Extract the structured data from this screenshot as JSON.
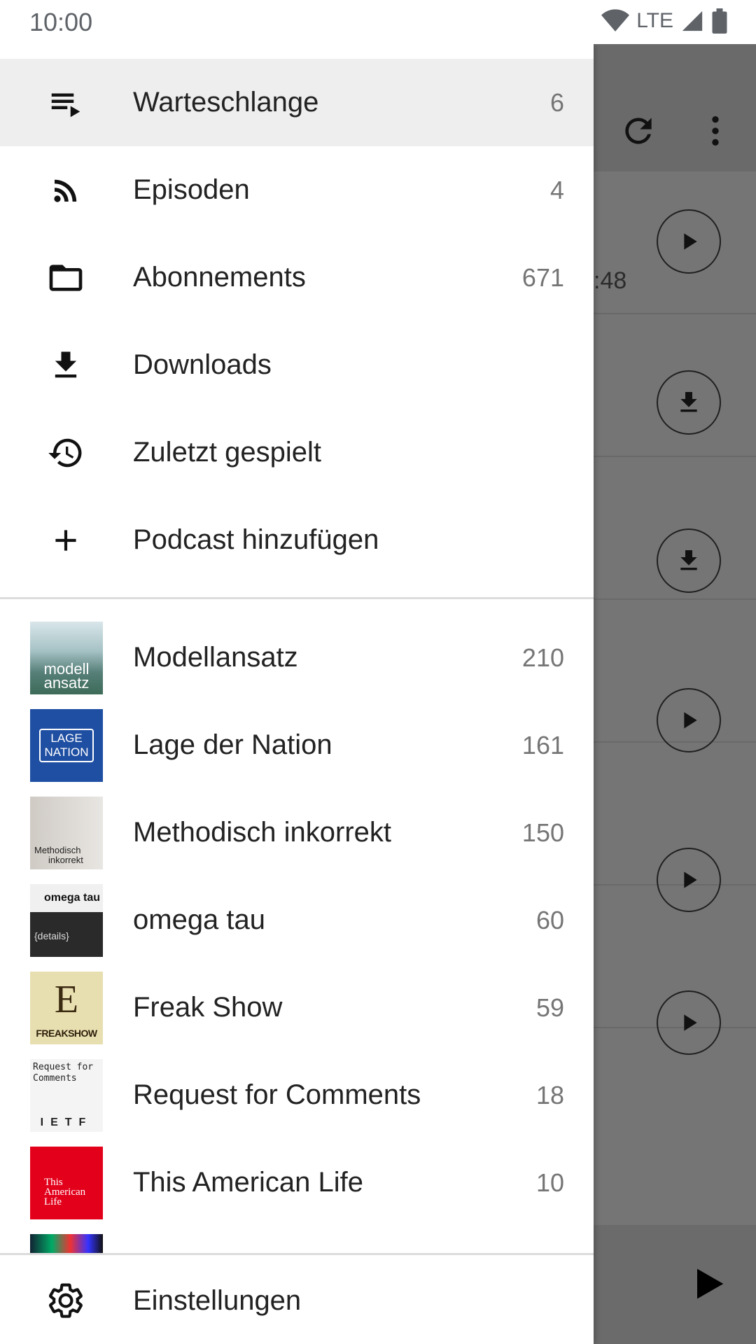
{
  "status_bar": {
    "time": "10:00",
    "network": "LTE"
  },
  "background": {
    "timestamp_fragment": ":48"
  },
  "drawer": {
    "nav_items": [
      {
        "label": "Warteschlange",
        "count": "6",
        "icon": "queue-icon",
        "active": true
      },
      {
        "label": "Episoden",
        "count": "4",
        "icon": "rss-icon"
      },
      {
        "label": "Abonnements",
        "count": "671",
        "icon": "folder-icon"
      },
      {
        "label": "Downloads",
        "count": "",
        "icon": "download-icon"
      },
      {
        "label": "Zuletzt gespielt",
        "count": "",
        "icon": "history-icon"
      },
      {
        "label": "Podcast hinzufügen",
        "count": "",
        "icon": "add-icon"
      }
    ],
    "feeds": [
      {
        "label": "Modellansatz",
        "count": "210",
        "thumb_text": [
          "modell",
          "ansatz"
        ]
      },
      {
        "label": "Lage der Nation",
        "count": "161",
        "thumb_text": [
          "LAGE",
          "NATION"
        ]
      },
      {
        "label": "Methodisch inkorrekt",
        "count": "150",
        "thumb_text": [
          "Methodisch",
          "inkorrekt"
        ]
      },
      {
        "label": "omega tau",
        "count": "60",
        "thumb_text": [
          "omega tau",
          "{details}"
        ]
      },
      {
        "label": "Freak Show",
        "count": "59",
        "thumb_text": [
          "E",
          "FREAKSHOW"
        ]
      },
      {
        "label": "Request for Comments",
        "count": "18",
        "thumb_text": [
          "Request for",
          "Comments",
          "IETF"
        ]
      },
      {
        "label": "This American Life",
        "count": "10",
        "thumb_text": [
          "This",
          "American",
          "Life"
        ]
      }
    ],
    "settings_label": "Einstellungen"
  }
}
